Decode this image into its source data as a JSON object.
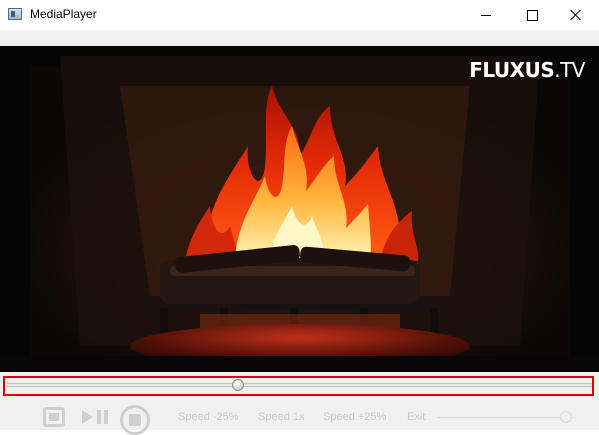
{
  "window": {
    "title": "MediaPlayer",
    "app_icon": "app-window-icon",
    "buttons": {
      "minimize": "minimize-icon",
      "maximize": "maximize-icon",
      "close": "close-icon"
    }
  },
  "video": {
    "watermark_brand": "FLUXUS",
    "watermark_suffix": ".TV",
    "content": "fireplace-video-frame"
  },
  "seek": {
    "position_fraction": 0.395,
    "highlight_color": "#e00000"
  },
  "controls": {
    "icons": [
      "fullscreen-icon",
      "play-pause-icon",
      "stop-icon"
    ],
    "speed_minus": "Speed -25%",
    "speed_normal": "Speed 1x",
    "speed_plus": "Speed +25%",
    "exit": "Exit",
    "volume_fraction": 0.94,
    "disabled_color": "#c8c8c8"
  }
}
